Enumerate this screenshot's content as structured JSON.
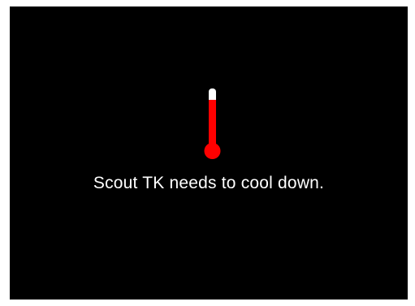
{
  "screen": {
    "background_color": "#000000",
    "page_color": "#ffffff"
  },
  "icon": {
    "name": "thermometer-icon",
    "level": 0.82,
    "fill_color": "#ff0000",
    "empty_color": "#ffffff"
  },
  "message": {
    "text": "Scout TK needs to cool down.",
    "color": "#ffffff"
  }
}
